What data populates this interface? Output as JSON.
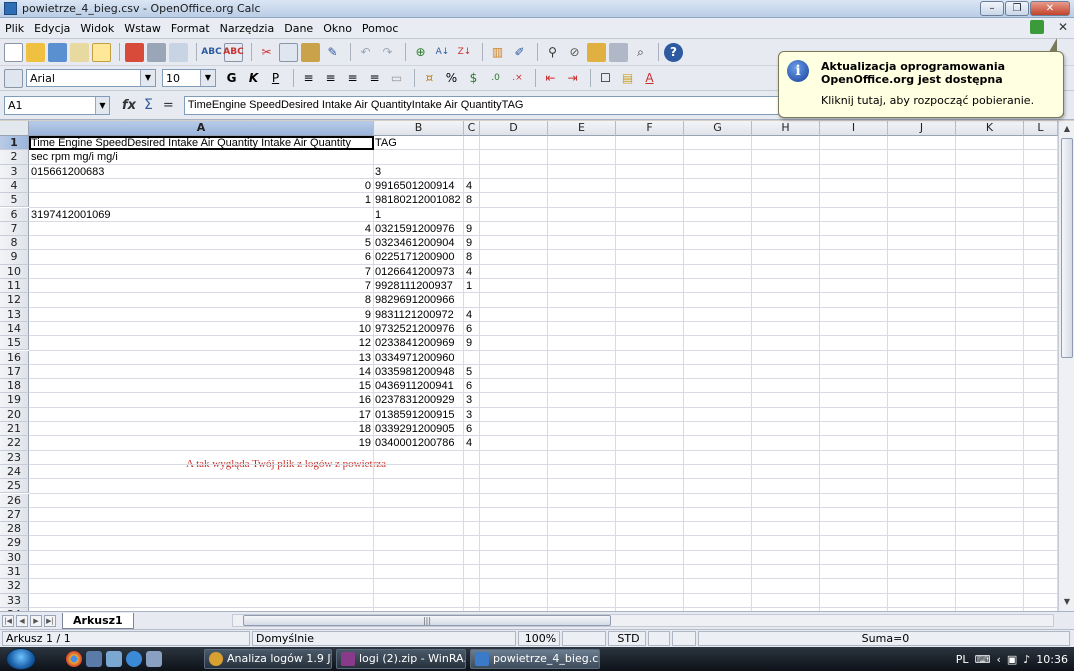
{
  "window": {
    "title": "powietrze_4_bieg.csv - OpenOffice.org Calc"
  },
  "menu": [
    "Plik",
    "Edycja",
    "Widok",
    "Wstaw",
    "Format",
    "Narzędzia",
    "Dane",
    "Okno",
    "Pomoc"
  ],
  "format_toolbar": {
    "font_name": "Arial",
    "font_size": "10",
    "bold": "G",
    "italic": "K",
    "underline": "P"
  },
  "formula_bar": {
    "cell_ref": "A1",
    "fx": "fx",
    "sigma": "Σ",
    "equals": "=",
    "content": "TimeEngine SpeedDesired Intake Air QuantityIntake Air QuantityTAG"
  },
  "columns": [
    "A",
    "B",
    "C",
    "D",
    "E",
    "F",
    "G",
    "H",
    "I",
    "J",
    "K",
    "L"
  ],
  "row_numbers": [
    "1",
    "2",
    "3",
    "4",
    "5",
    "6",
    "7",
    "8",
    "9",
    "10",
    "11",
    "12",
    "13",
    "14",
    "15",
    "16",
    "17",
    "18",
    "19",
    "20",
    "21",
    "22",
    "23",
    "24",
    "25",
    "26",
    "27",
    "28",
    "29",
    "30",
    "31",
    "32",
    "33",
    "34"
  ],
  "rows": [
    {
      "a": "Time       Engine SpeedDesired Intake Air Quantity  Intake Air Quantity",
      "b": "TAG",
      "c": ""
    },
    {
      "a": "sec  rpm  mg/i mg/i",
      "b": "",
      "c": ""
    },
    {
      "a": "015661200683",
      "b": "3",
      "c": ""
    },
    {
      "a_num": "0",
      "b": "9916501200914",
      "c": "4"
    },
    {
      "a_num": "1",
      "b": "98180212001082",
      "c": "8"
    },
    {
      "a": "3197412001069",
      "b": "1",
      "c": ""
    },
    {
      "a_num": "4",
      "b": "0321591200976",
      "c": "9"
    },
    {
      "a_num": "5",
      "b": "0323461200904",
      "c": "9"
    },
    {
      "a_num": "6",
      "b": "0225171200900",
      "c": "8"
    },
    {
      "a_num": "7",
      "b": "0126641200973",
      "c": "4"
    },
    {
      "a_num": "7",
      "b": "9928111200937",
      "c": "1"
    },
    {
      "a_num": "8",
      "b": "9829691200966",
      "c": ""
    },
    {
      "a_num": "9",
      "b": "9831121200972",
      "c": "4"
    },
    {
      "a_num": "10",
      "b": "9732521200976",
      "c": "6"
    },
    {
      "a_num": "12",
      "b": "0233841200969",
      "c": "9"
    },
    {
      "a_num": "13",
      "b": "0334971200960",
      "c": ""
    },
    {
      "a_num": "14",
      "b": "0335981200948",
      "c": "5"
    },
    {
      "a_num": "15",
      "b": "0436911200941",
      "c": "6"
    },
    {
      "a_num": "16",
      "b": "0237831200929",
      "c": "3"
    },
    {
      "a_num": "17",
      "b": "0138591200915",
      "c": "3"
    },
    {
      "a_num": "18",
      "b": "0339291200905",
      "c": "6"
    },
    {
      "a_num": "19",
      "b": "0340001200786",
      "c": "4"
    }
  ],
  "annotation": "A tak wygląda Twój plik z logów z powietrza",
  "sheet_tab": "Arkusz1",
  "status": {
    "sheet": "Arkusz 1 / 1",
    "style": "Domyślnie",
    "zoom": "100%",
    "mode": "STD",
    "sum": "Suma=0"
  },
  "taskbar": {
    "tasks": [
      "Analiza logów 1.9 JT...",
      "logi (2).zip - WinRA...",
      "powietrze_4_bieg.cs..."
    ],
    "lang": "PL",
    "clock": "10:36"
  },
  "notification": {
    "title": "Aktualizacja oprogramowania OpenOffice.org jest dostępna",
    "text": "Kliknij tutaj, aby rozpocząć pobieranie."
  },
  "colors": {
    "annotation": "#c8322c",
    "balloon_bg": "#ffffe1",
    "selection": "#9ab4dc"
  }
}
